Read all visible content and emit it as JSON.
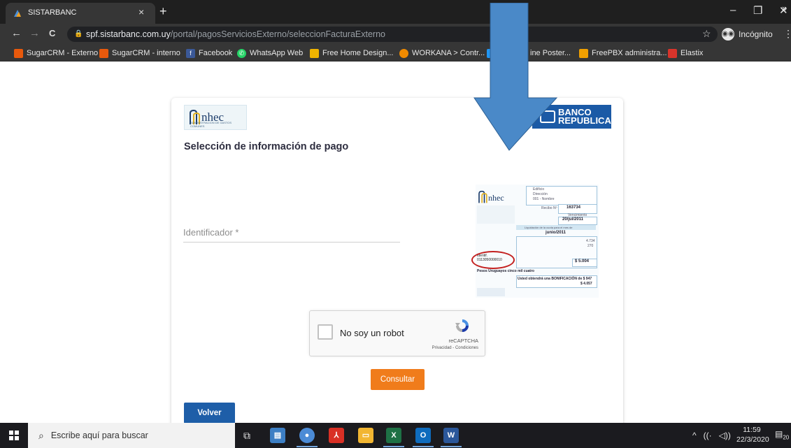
{
  "browser": {
    "tab_title": "SISTARBANC",
    "tab_close": "×",
    "new_tab": "+",
    "window_controls": {
      "minimize": "–",
      "restore": "❐",
      "close": "✕"
    },
    "nav": {
      "back": "←",
      "forward": "→",
      "reload": "C"
    },
    "url_domain": "spf.sistarbanc.com.uy",
    "url_path": "/portal/pagosServiciosExterno/seleccionFacturaExterno",
    "bookmark_star": "☆",
    "incognito_label": "Incógnito",
    "menu": "⋮"
  },
  "bookmarks": [
    {
      "label": "SugarCRM - Externo",
      "color": "#e8590c"
    },
    {
      "label": "SugarCRM - interno",
      "color": "#e8590c"
    },
    {
      "label": "Facebook",
      "color": "#3b5998"
    },
    {
      "label": "WhatsApp Web",
      "color": "#25d366"
    },
    {
      "label": "Free Home Design...",
      "color": "#f0b400"
    },
    {
      "label": "WORKANA > Contr...",
      "color": "#f08a00"
    },
    {
      "label": "ine Poster...",
      "color": "#2196f3"
    },
    {
      "label": "FreePBX administra...",
      "color": "#f0a000"
    },
    {
      "label": "Elastix",
      "color": "#d9342b"
    }
  ],
  "bookmarks_more": "»",
  "page": {
    "heading": "Selección de información de pago",
    "anhec_logo_text": "nhec",
    "anhec_logo_sub": "ADMINISTRACION DE GASTOS COMUNES",
    "banco_logo_line1": "BANCO",
    "banco_logo_line2": "REPUBLICA",
    "identifier_label": "Identificador *",
    "invoice": {
      "logo_text": "nhec",
      "building": "Edificio",
      "address": "Dirección",
      "unit": "001 - Nombre",
      "recibo_label": "Recibo Nº",
      "recibo": "163734",
      "due_label": "Vencimiento",
      "due": "20/jul/2011",
      "period_caption": "Liquidación de la cuota para el mes de",
      "period": "junio/2011",
      "amount1": "4.734",
      "amount2": "270",
      "ident_label": "Identif.",
      "ident_value": "0113050000010",
      "total": "$ 5.004",
      "pesos_line": "Pesos Uruguayos cinco mil cuatro",
      "bonif": "Usted obtendrá una BONIFICACIÓN de $ 947",
      "bonif_total": "$ 4.057"
    },
    "captcha": {
      "label": "No soy un robot",
      "brand": "reCAPTCHA",
      "links": "Privacidad - Condiciones"
    },
    "consultar_label": "Consultar",
    "volver_label": "Volver"
  },
  "taskbar": {
    "search_placeholder": "Escribe aquí para buscar",
    "time": "11:59",
    "date": "22/3/2020",
    "notifications": "20",
    "tray_up": "^",
    "tray_wifi": "((·",
    "tray_volume": "◁))"
  },
  "colors": {
    "arrow": "#4a89c8",
    "consultar": "#f07c1b",
    "volver": "#1e5ea8",
    "banco": "#1b5aa6"
  }
}
